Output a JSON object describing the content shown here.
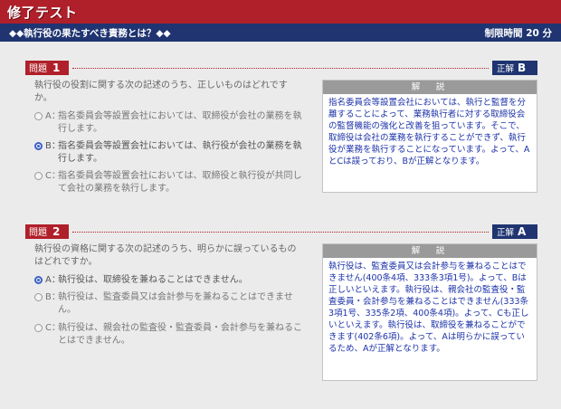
{
  "app": {
    "title": "修了テスト"
  },
  "header": {
    "question_text": "◆◆執行役の果たすべき責務とは？◆◆",
    "time_limit": "制限時間 20 分"
  },
  "questions": [
    {
      "label": "問題",
      "number": "1",
      "answer_label": "正解",
      "answer": "B",
      "prompt": "執行役の役割に関する次の記述のうち、正しいものはどれですか。",
      "options": [
        {
          "letter": "A：",
          "text": "指名委員会等設置会社においては、取締役が会社の業務を執行します。"
        },
        {
          "letter": "B：",
          "text": "指名委員会等設置会社においては、執行役が会社の業務を執行します。"
        },
        {
          "letter": "C：",
          "text": "指名委員会等設置会社においては、取締役と執行役が共同して会社の業務を執行します。"
        }
      ],
      "selected": "B",
      "explanation_title": "解　説",
      "explanation": "指名委員会等設置会社においては、執行と監督を分離することによって、業務執行者に対する取締役会の監督機能の強化と改善を狙っています。そこで、取締役は会社の業務を執行することができず、執行役が業務を執行することになっています。よって、AとCは誤っており、Bが正解となります。"
    },
    {
      "label": "問題",
      "number": "2",
      "answer_label": "正解",
      "answer": "A",
      "prompt": "執行役の資格に関する次の記述のうち、明らかに誤っているものはどれですか。",
      "options": [
        {
          "letter": "A：",
          "text": "執行役は、取締役を兼ねることはできません。"
        },
        {
          "letter": "B：",
          "text": "執行役は、監査委員又は会計参与を兼ねることはできません。"
        },
        {
          "letter": "C：",
          "text": "執行役は、親会社の監査役・監査委員・会計参与を兼ねることはできません。"
        }
      ],
      "selected": "A",
      "explanation_title": "解　説",
      "explanation": "執行役は、監査委員又は会計参与を兼ねることはできません(400条4項、333条3項1号)。よって、Bは正しいといえます。執行役は、親会社の監査役・監査委員・会計参与を兼ねることはできません(333条3項1号、335条2項、400条4項)。よって、Cも正しいといえます。執行役は、取締役を兼ねることができます(402条6項)。よって、Aは明らかに誤っているため、Aが正解となります。"
    }
  ],
  "colors": {
    "header_red": "#b0202a",
    "navy": "#1f3470",
    "explain_text": "#1d33a8"
  }
}
